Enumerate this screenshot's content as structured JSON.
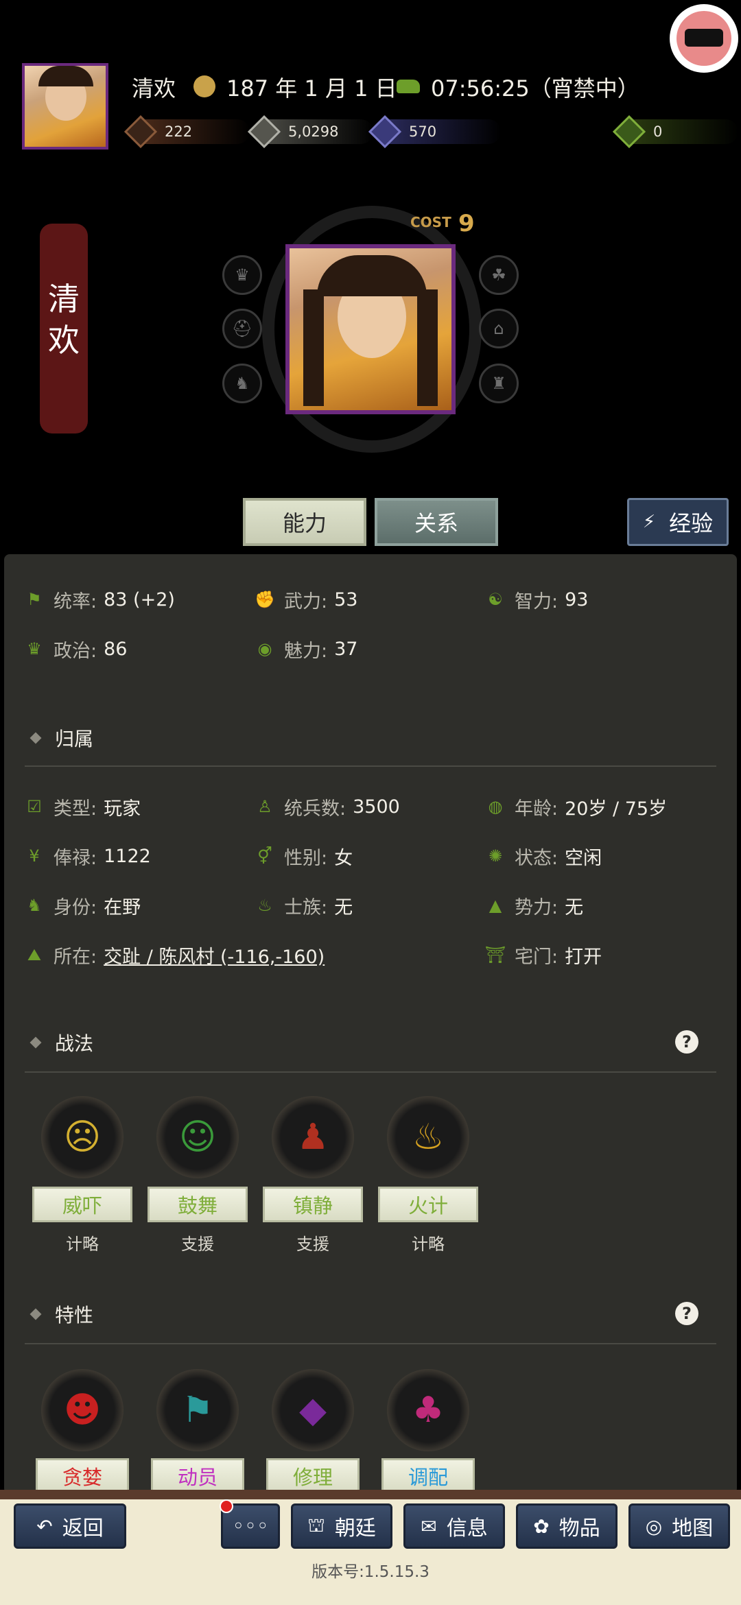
{
  "header": {
    "player_name": "清欢",
    "date": "187 年 1 月 1 日",
    "time": "07:56:25（宵禁中）",
    "resources": [
      {
        "icon": "copper-coin-icon",
        "value": "222",
        "color": "#7a4a2a"
      },
      {
        "icon": "silver-ingot-icon",
        "value": "5,0298",
        "color": "#8a8a8a"
      },
      {
        "icon": "strength-icon",
        "value": "570",
        "color": "#4a4a8a"
      },
      {
        "icon": "money-bag-icon",
        "value": "0",
        "color": "#5a7a1a"
      }
    ]
  },
  "character": {
    "name_chars": [
      "清",
      "欢"
    ],
    "cost_label": "COST",
    "cost_value": "9"
  },
  "tabs": {
    "ability": "能力",
    "relation": "关系",
    "experience": "经验"
  },
  "attributes": [
    {
      "label": "统率:",
      "value": "83 (+2)",
      "icon": "flag-icon"
    },
    {
      "label": "武力:",
      "value": "53",
      "icon": "muscle-icon"
    },
    {
      "label": "智力:",
      "value": "93",
      "icon": "brain-icon"
    },
    {
      "label": "政治:",
      "value": "86",
      "icon": "crown-icon"
    },
    {
      "label": "魅力:",
      "value": "37",
      "icon": "eye-icon"
    }
  ],
  "affiliation": {
    "title": "归属",
    "rows": [
      {
        "label": "类型:",
        "value": "玩家",
        "icon": "calendar-icon"
      },
      {
        "label": "统兵数:",
        "value": "3500",
        "icon": "soldier-icon"
      },
      {
        "label": "年龄:",
        "value": "20岁 / 75岁",
        "icon": "age-icon"
      },
      {
        "label": "俸禄:",
        "value": "1122",
        "icon": "yen-icon"
      },
      {
        "label": "性别:",
        "value": "女",
        "icon": "gender-icon"
      },
      {
        "label": "状态:",
        "value": "空闲",
        "icon": "status-icon"
      },
      {
        "label": "身份:",
        "value": "在野",
        "icon": "identity-icon"
      },
      {
        "label": "士族:",
        "value": "无",
        "icon": "clan-icon"
      },
      {
        "label": "势力:",
        "value": "无",
        "icon": "faction-icon"
      }
    ],
    "location_label": "所在:",
    "location_value": "交趾 / 陈风村 (-116,-160)",
    "gate_label": "宅门:",
    "gate_value": "打开"
  },
  "tactics": {
    "title": "战法",
    "items": [
      {
        "name": "威吓",
        "type": "计略",
        "color": "#7fae3a",
        "glyph": "☹",
        "glyph_color": "#d4b030"
      },
      {
        "name": "鼓舞",
        "type": "支援",
        "color": "#7fae3a",
        "glyph": "☺",
        "glyph_color": "#3a9a3a"
      },
      {
        "name": "镇静",
        "type": "支援",
        "color": "#7fae3a",
        "glyph": "♟",
        "glyph_color": "#b03020"
      },
      {
        "name": "火计",
        "type": "计略",
        "color": "#7fae3a",
        "glyph": "♨",
        "glyph_color": "#d4a020"
      }
    ]
  },
  "traits": {
    "title": "特性",
    "items": [
      {
        "name": "贪婪",
        "color": "#d82a2a",
        "glyph": "☻",
        "glyph_color": "#c82020"
      },
      {
        "name": "动员",
        "color": "#c030c0",
        "glyph": "⚑",
        "glyph_color": "#2a9a9a"
      },
      {
        "name": "修理",
        "color": "#7fae3a",
        "glyph": "◆",
        "glyph_color": "#7a2a9a"
      },
      {
        "name": "调配",
        "color": "#2a9ad8",
        "glyph": "♣",
        "glyph_color": "#c02a7a"
      }
    ]
  },
  "bottom_nav": {
    "back": "返回",
    "more": "◦◦◦",
    "court": "朝廷",
    "info": "信息",
    "items": "物品",
    "map": "地图",
    "version": "版本号:1.5.15.3"
  }
}
